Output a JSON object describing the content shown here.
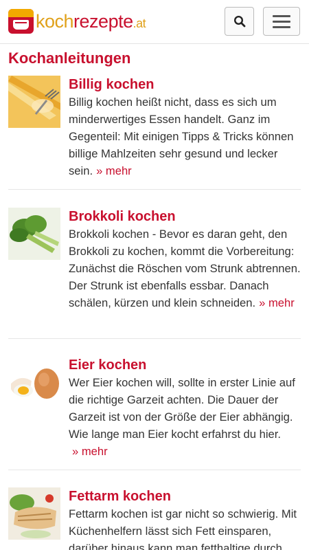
{
  "header": {
    "logo": {
      "part1": "koch",
      "part2": "rezepte",
      "part3": ".at"
    },
    "search_icon": "search-icon",
    "menu_icon": "hamburger-menu-icon"
  },
  "colors": {
    "brand": "#c8102e",
    "accent": "#f2a900",
    "text": "#333333"
  },
  "page_title": "Kochanleitungen",
  "articles": [
    {
      "title": "Billig kochen",
      "text": "Billig kochen heißt nicht, dass es sich um minderwertiges Essen handelt. Ganz im Gegenteil: Mit einigen Tipps & Tricks können billige Mahlzeiten sehr gesund und lecker sein.",
      "more": "» mehr"
    },
    {
      "title": "Brokkoli kochen",
      "text": "Brokkoli kochen - Bevor es daran geht, den Brokkoli zu kochen, kommt die Vorbereitung: Zunächst die Röschen vom Strunk abtrennen. Der Strunk ist ebenfalls essbar. Danach schälen, kürzen und klein schneiden.",
      "more": "» mehr"
    },
    {
      "title": "Eier kochen",
      "text": "Wer Eier kochen will, sollte in erster Linie auf die richtige Garzeit achten. Die Dauer der Garzeit ist von der Größe der Eier abhängig. Wie lange man Eier kocht erfahrst du hier.",
      "more": "» mehr"
    },
    {
      "title": "Fettarm kochen",
      "text": "Fettarm kochen ist gar nicht so schwierig. Mit Küchenhelfern lässt sich Fett einsparen, darüber hinaus kann man fetthaltige durch",
      "more": ""
    }
  ]
}
